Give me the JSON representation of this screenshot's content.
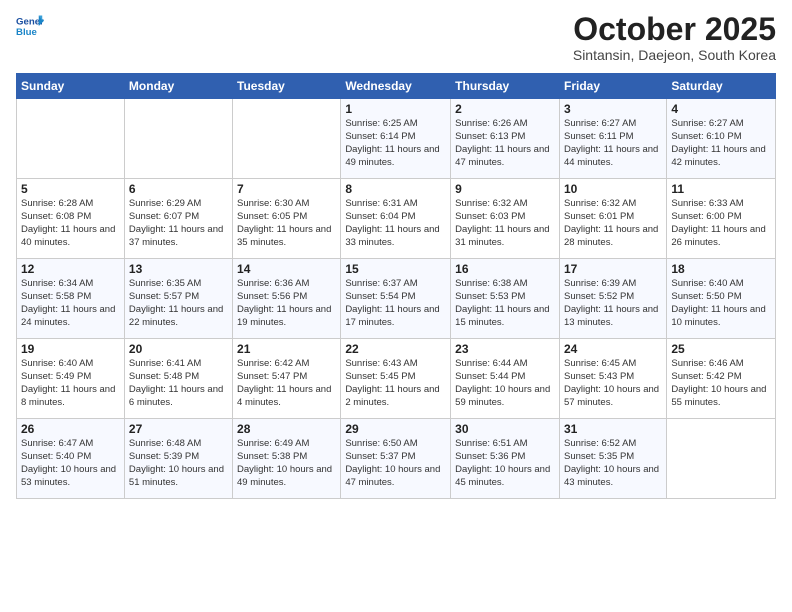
{
  "header": {
    "logo_line1": "General",
    "logo_line2": "Blue",
    "month_title": "October 2025",
    "subtitle": "Sintansin, Daejeon, South Korea"
  },
  "days_of_week": [
    "Sunday",
    "Monday",
    "Tuesday",
    "Wednesday",
    "Thursday",
    "Friday",
    "Saturday"
  ],
  "weeks": [
    [
      {
        "day": "",
        "info": ""
      },
      {
        "day": "",
        "info": ""
      },
      {
        "day": "",
        "info": ""
      },
      {
        "day": "1",
        "info": "Sunrise: 6:25 AM\nSunset: 6:14 PM\nDaylight: 11 hours\nand 49 minutes."
      },
      {
        "day": "2",
        "info": "Sunrise: 6:26 AM\nSunset: 6:13 PM\nDaylight: 11 hours\nand 47 minutes."
      },
      {
        "day": "3",
        "info": "Sunrise: 6:27 AM\nSunset: 6:11 PM\nDaylight: 11 hours\nand 44 minutes."
      },
      {
        "day": "4",
        "info": "Sunrise: 6:27 AM\nSunset: 6:10 PM\nDaylight: 11 hours\nand 42 minutes."
      }
    ],
    [
      {
        "day": "5",
        "info": "Sunrise: 6:28 AM\nSunset: 6:08 PM\nDaylight: 11 hours\nand 40 minutes."
      },
      {
        "day": "6",
        "info": "Sunrise: 6:29 AM\nSunset: 6:07 PM\nDaylight: 11 hours\nand 37 minutes."
      },
      {
        "day": "7",
        "info": "Sunrise: 6:30 AM\nSunset: 6:05 PM\nDaylight: 11 hours\nand 35 minutes."
      },
      {
        "day": "8",
        "info": "Sunrise: 6:31 AM\nSunset: 6:04 PM\nDaylight: 11 hours\nand 33 minutes."
      },
      {
        "day": "9",
        "info": "Sunrise: 6:32 AM\nSunset: 6:03 PM\nDaylight: 11 hours\nand 31 minutes."
      },
      {
        "day": "10",
        "info": "Sunrise: 6:32 AM\nSunset: 6:01 PM\nDaylight: 11 hours\nand 28 minutes."
      },
      {
        "day": "11",
        "info": "Sunrise: 6:33 AM\nSunset: 6:00 PM\nDaylight: 11 hours\nand 26 minutes."
      }
    ],
    [
      {
        "day": "12",
        "info": "Sunrise: 6:34 AM\nSunset: 5:58 PM\nDaylight: 11 hours\nand 24 minutes."
      },
      {
        "day": "13",
        "info": "Sunrise: 6:35 AM\nSunset: 5:57 PM\nDaylight: 11 hours\nand 22 minutes."
      },
      {
        "day": "14",
        "info": "Sunrise: 6:36 AM\nSunset: 5:56 PM\nDaylight: 11 hours\nand 19 minutes."
      },
      {
        "day": "15",
        "info": "Sunrise: 6:37 AM\nSunset: 5:54 PM\nDaylight: 11 hours\nand 17 minutes."
      },
      {
        "day": "16",
        "info": "Sunrise: 6:38 AM\nSunset: 5:53 PM\nDaylight: 11 hours\nand 15 minutes."
      },
      {
        "day": "17",
        "info": "Sunrise: 6:39 AM\nSunset: 5:52 PM\nDaylight: 11 hours\nand 13 minutes."
      },
      {
        "day": "18",
        "info": "Sunrise: 6:40 AM\nSunset: 5:50 PM\nDaylight: 11 hours\nand 10 minutes."
      }
    ],
    [
      {
        "day": "19",
        "info": "Sunrise: 6:40 AM\nSunset: 5:49 PM\nDaylight: 11 hours\nand 8 minutes."
      },
      {
        "day": "20",
        "info": "Sunrise: 6:41 AM\nSunset: 5:48 PM\nDaylight: 11 hours\nand 6 minutes."
      },
      {
        "day": "21",
        "info": "Sunrise: 6:42 AM\nSunset: 5:47 PM\nDaylight: 11 hours\nand 4 minutes."
      },
      {
        "day": "22",
        "info": "Sunrise: 6:43 AM\nSunset: 5:45 PM\nDaylight: 11 hours\nand 2 minutes."
      },
      {
        "day": "23",
        "info": "Sunrise: 6:44 AM\nSunset: 5:44 PM\nDaylight: 10 hours\nand 59 minutes."
      },
      {
        "day": "24",
        "info": "Sunrise: 6:45 AM\nSunset: 5:43 PM\nDaylight: 10 hours\nand 57 minutes."
      },
      {
        "day": "25",
        "info": "Sunrise: 6:46 AM\nSunset: 5:42 PM\nDaylight: 10 hours\nand 55 minutes."
      }
    ],
    [
      {
        "day": "26",
        "info": "Sunrise: 6:47 AM\nSunset: 5:40 PM\nDaylight: 10 hours\nand 53 minutes."
      },
      {
        "day": "27",
        "info": "Sunrise: 6:48 AM\nSunset: 5:39 PM\nDaylight: 10 hours\nand 51 minutes."
      },
      {
        "day": "28",
        "info": "Sunrise: 6:49 AM\nSunset: 5:38 PM\nDaylight: 10 hours\nand 49 minutes."
      },
      {
        "day": "29",
        "info": "Sunrise: 6:50 AM\nSunset: 5:37 PM\nDaylight: 10 hours\nand 47 minutes."
      },
      {
        "day": "30",
        "info": "Sunrise: 6:51 AM\nSunset: 5:36 PM\nDaylight: 10 hours\nand 45 minutes."
      },
      {
        "day": "31",
        "info": "Sunrise: 6:52 AM\nSunset: 5:35 PM\nDaylight: 10 hours\nand 43 minutes."
      },
      {
        "day": "",
        "info": ""
      }
    ]
  ]
}
